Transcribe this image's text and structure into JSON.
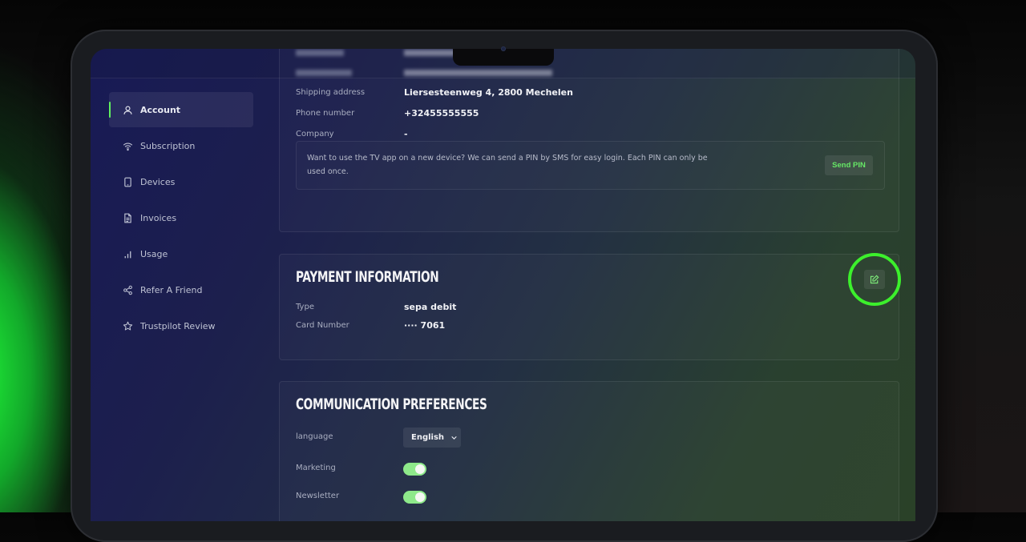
{
  "sidebar": {
    "items": [
      {
        "label": "Account",
        "icon": "user-icon",
        "active": true
      },
      {
        "label": "Subscription",
        "icon": "wifi-icon"
      },
      {
        "label": "Devices",
        "icon": "tablet-icon"
      },
      {
        "label": "Invoices",
        "icon": "document-icon"
      },
      {
        "label": "Usage",
        "icon": "bar-chart-icon"
      },
      {
        "label": "Refer A Friend",
        "icon": "share-icon"
      },
      {
        "label": "Trustpilot Review",
        "icon": "star-icon"
      }
    ]
  },
  "account": {
    "rows": [
      {
        "label": "Shipping address",
        "value": "Liersesteenweg 4, 2800 Mechelen"
      },
      {
        "label": "Phone number",
        "value": "+32455555555"
      },
      {
        "label": "Company",
        "value": "-"
      }
    ],
    "pin": {
      "text": "Want to use the TV app on a new device? We can send a PIN by SMS for easy login. Each PIN can only be used once.",
      "button": "Send PIN"
    }
  },
  "payment": {
    "title": "PAYMENT INFORMATION",
    "rows": [
      {
        "label": "Type",
        "value": "sepa debit"
      },
      {
        "label": "Card Number",
        "value": "···· 7061"
      }
    ],
    "edit_icon": "edit-icon"
  },
  "communication": {
    "title": "COMMUNICATION PREFERENCES",
    "language_label": "language",
    "language_value": "English",
    "marketing_label": "Marketing",
    "marketing_on": true,
    "newsletter_label": "Newsletter",
    "newsletter_on": true
  },
  "colors": {
    "accent": "#5ff05f",
    "highlight_ring": "#3cf02c",
    "toggle_on": "#8ee98a"
  }
}
